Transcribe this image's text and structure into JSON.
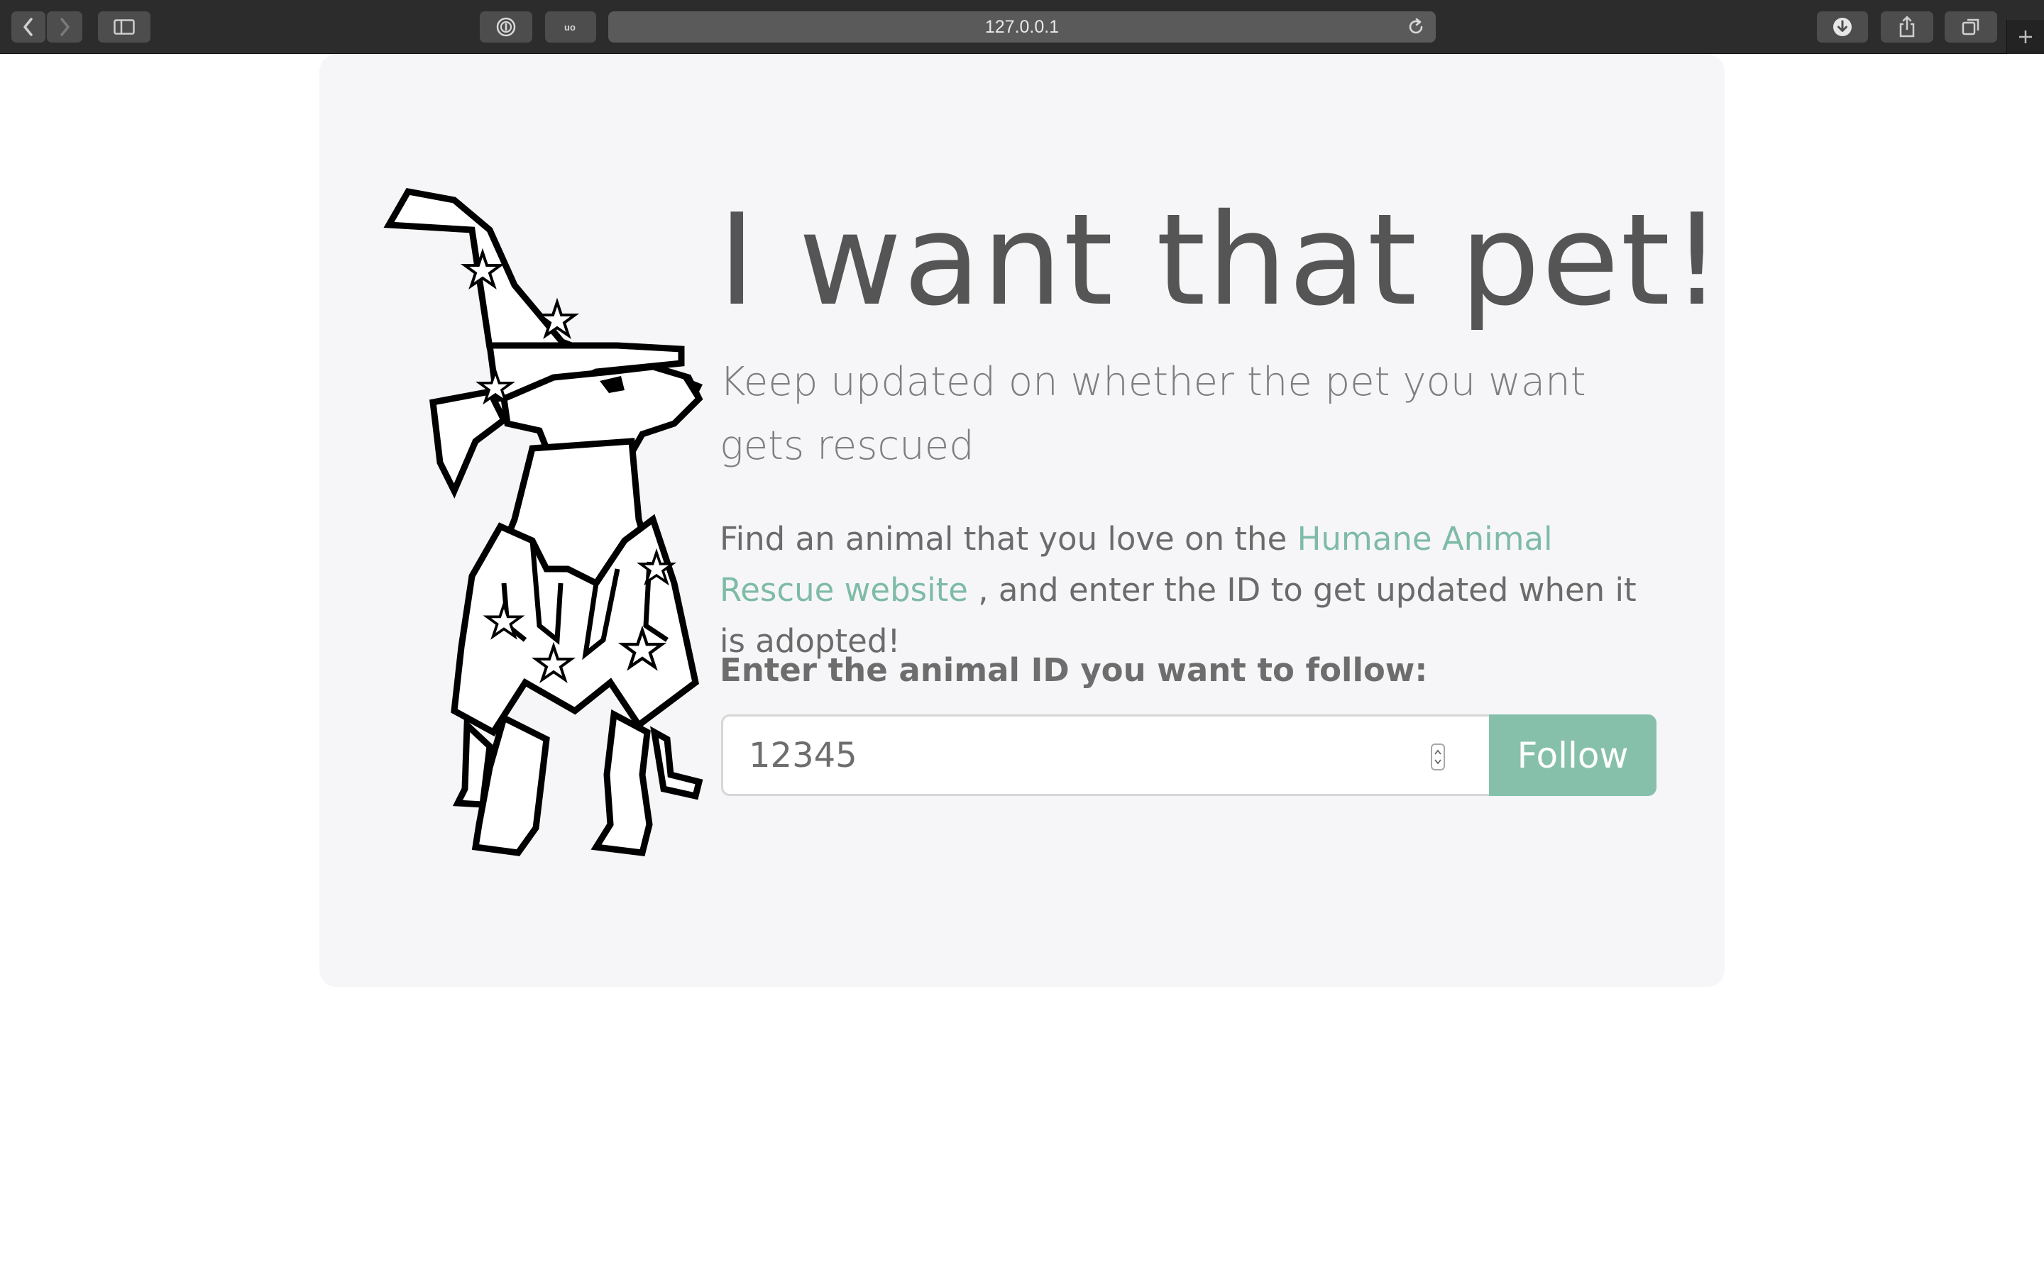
{
  "browser": {
    "url": "127.0.0.1"
  },
  "hero": {
    "title": "I want that pet!",
    "lead": "Keep updated on whether the pet you want gets rescued",
    "desc_prefix": "Find an animal that you love on the ",
    "desc_link": "Humane Animal Rescue website",
    "desc_suffix": " , and enter the ID to get updated when it is adopted!",
    "input_label": "Enter the animal ID you want to follow:",
    "animal_id_value": "12345",
    "follow_label": "Follow"
  },
  "colors": {
    "accent": "#86c0ab",
    "link": "#7fbba6",
    "jumbotron_bg": "#f6f6f8"
  },
  "icons": {
    "back": "chevron-left-icon",
    "forward": "chevron-right-icon",
    "sidebar": "sidebar-icon",
    "password": "password-icon",
    "extension": "extension-icon",
    "reload": "reload-icon",
    "downloads": "download-icon",
    "share": "share-icon",
    "tabs": "tab-overview-icon",
    "new_tab": "plus-icon",
    "mascot": "wizard-dog-illustration"
  }
}
